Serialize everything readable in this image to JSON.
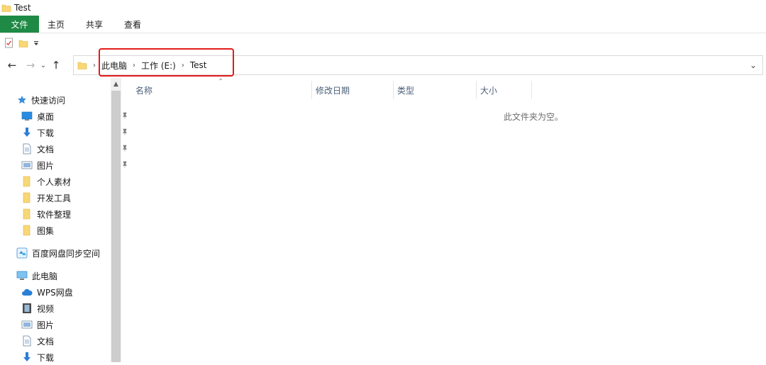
{
  "window": {
    "title": "Test"
  },
  "ribbon": {
    "tabs": [
      {
        "label": "文件",
        "active": true
      },
      {
        "label": "主页"
      },
      {
        "label": "共享"
      },
      {
        "label": "查看"
      }
    ],
    "file_tab_color": "#1e8a45"
  },
  "address": {
    "breadcrumb": [
      "此电脑",
      "工作 (E:)",
      "Test"
    ],
    "highlight_color": "#e41b1b"
  },
  "sidebar": {
    "quick_access": {
      "label": "快速访问",
      "icon": "star-icon"
    },
    "pinned": [
      {
        "label": "桌面",
        "icon": "desktop-icon"
      },
      {
        "label": "下载",
        "icon": "download-icon"
      },
      {
        "label": "文档",
        "icon": "document-icon"
      },
      {
        "label": "图片",
        "icon": "pictures-icon"
      }
    ],
    "folders": [
      {
        "label": "个人素材",
        "icon": "folder-icon"
      },
      {
        "label": "开发工具",
        "icon": "folder-icon"
      },
      {
        "label": "软件整理",
        "icon": "folder-icon"
      },
      {
        "label": "图集",
        "icon": "folder-icon"
      }
    ],
    "baidu": {
      "label": "百度网盘同步空间",
      "icon": "cloud-sync-icon"
    },
    "this_pc": {
      "label": "此电脑",
      "icon": "computer-icon"
    },
    "pc_items": [
      {
        "label": "WPS网盘",
        "icon": "wps-cloud-icon"
      },
      {
        "label": "视频",
        "icon": "video-icon"
      },
      {
        "label": "图片",
        "icon": "pictures-icon"
      },
      {
        "label": "文档",
        "icon": "document-icon"
      },
      {
        "label": "下载",
        "icon": "download-icon"
      }
    ]
  },
  "list": {
    "columns": [
      "名称",
      "修改日期",
      "类型",
      "大小"
    ],
    "empty_message": "此文件夹为空。"
  }
}
